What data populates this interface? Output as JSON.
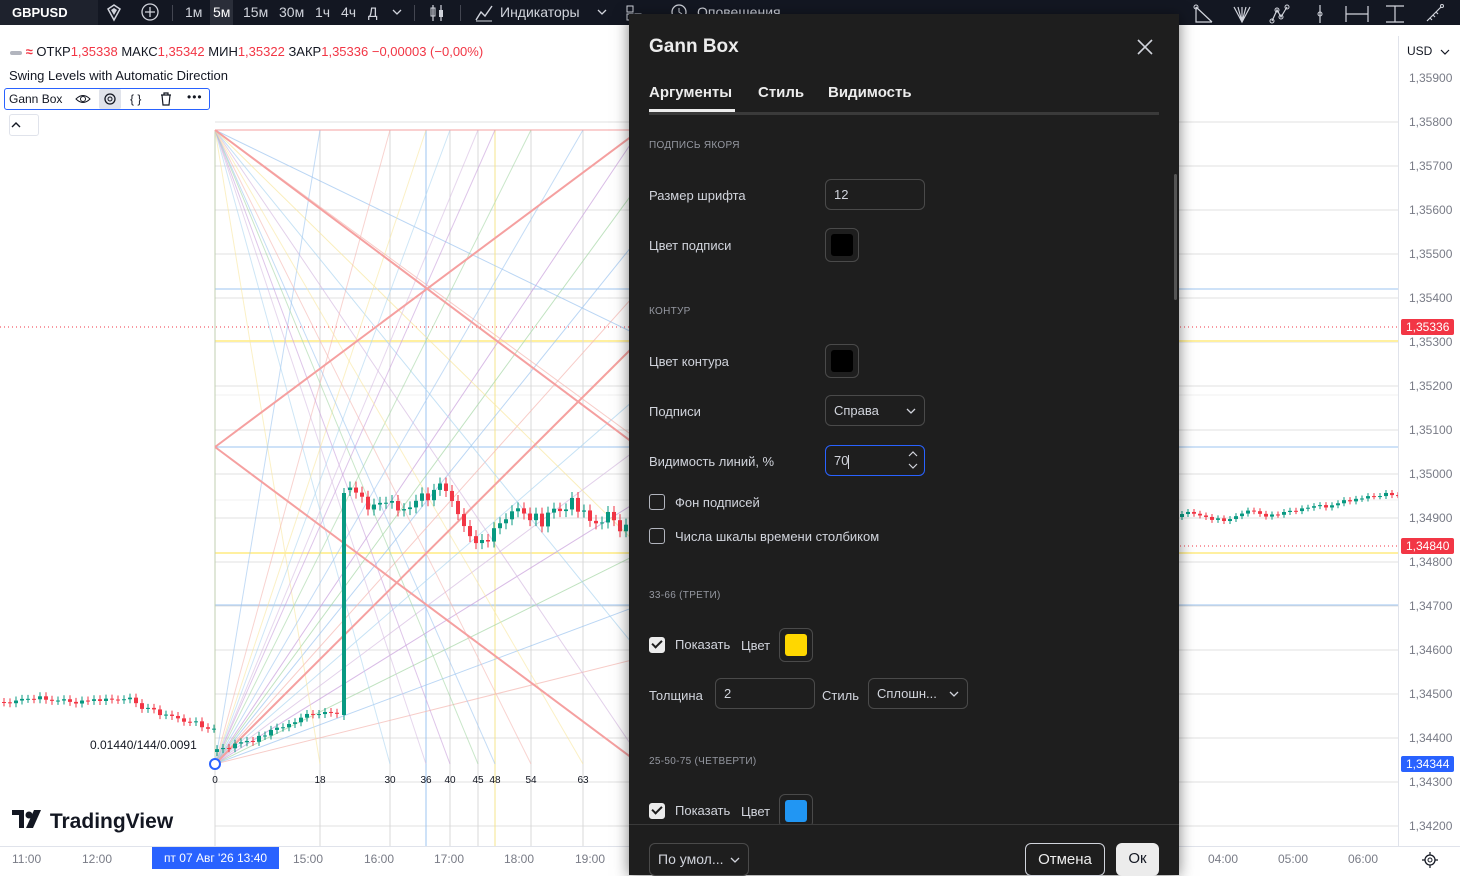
{
  "toolbar": {
    "symbol": "GBPUSD",
    "timeframes": [
      "1м",
      "5м",
      "15м",
      "30м",
      "1ч",
      "4ч",
      "Д"
    ],
    "active_timeframe": "5м",
    "indicators_label": "Индикаторы",
    "alerts_label": "Оповещения"
  },
  "legend": {
    "open_label": "ОТКР",
    "open_value": "1,35338",
    "high_label": "МАКС",
    "high_value": "1,35342",
    "low_label": "МИН",
    "low_value": "1,35322",
    "close_label": "ЗАКР",
    "close_value": "1,35336",
    "change": "−0,00003 (−0,00%)",
    "indicator_name": "Swing Levels with Automatic Direction",
    "drawing_name": "Gann Box"
  },
  "gann": {
    "anchor_label": "0.01440/144/0.0091",
    "time_labels": [
      "0",
      "18",
      "30",
      "36",
      "40",
      "45",
      "48",
      "54",
      "63"
    ]
  },
  "price_scale": {
    "currency": "USD",
    "labels": [
      "1,35900",
      "1,35800",
      "1,35700",
      "1,35600",
      "1,35500",
      "1,35400",
      "1,35300",
      "1,35200",
      "1,35100",
      "1,35000",
      "1,34900",
      "1,34800",
      "1,34700",
      "1,34600",
      "1,34500",
      "1,34400",
      "1,34300",
      "1,34200"
    ],
    "last_price": "1,35336",
    "current_price": "1,34840",
    "crosshair_price": "1,34344",
    "colors": {
      "last": "#f23645",
      "current": "#f23645",
      "crosshair": "#2962ff"
    }
  },
  "time_scale": {
    "labels": [
      "11:00",
      "12:00",
      "15:00",
      "16:00",
      "17:00",
      "18:00",
      "19:00",
      "04:00",
      "05:00",
      "06:00"
    ],
    "crosshair_time": "пт 07 Авг '26   13:40"
  },
  "branding": {
    "logo_text": "TradingView"
  },
  "dialog": {
    "title": "Gann Box",
    "tabs": [
      "Аргументы",
      "Стиль",
      "Видимость"
    ],
    "active_tab": "Аргументы",
    "sections": {
      "anchor": "ПОДПИСЬ ЯКОРЯ",
      "contour": "КОНТУР",
      "thirds": "33-66 (ТРЕТИ)",
      "quarters": "25-50-75 (ЧЕТВЕРТИ)"
    },
    "font_size_label": "Размер шрифта",
    "font_size_value": "12",
    "label_color_label": "Цвет подписи",
    "label_color": "#000000",
    "contour_color_label": "Цвет контура",
    "contour_color": "#000000",
    "labels_label": "Подписи",
    "labels_value": "Справа",
    "lines_visibility_label": "Видимость линий, %",
    "lines_visibility_value": "70",
    "labels_bg_label": "Фон подписей",
    "labels_bg_checked": false,
    "time_numbers_label": "Числа шкалы времени столбиком",
    "time_numbers_checked": false,
    "thirds": {
      "show_label": "Показать",
      "color_label": "Цвет",
      "checked": true,
      "color": "#ffd700",
      "thickness_label": "Толщина",
      "thickness_value": "2",
      "style_label": "Стиль",
      "style_value": "Сплошн..."
    },
    "quarters": {
      "show_label": "Показать",
      "color_label": "Цвет",
      "checked": true,
      "color": "#2196f3"
    },
    "footer": {
      "defaults": "По умол...",
      "cancel": "Отмена",
      "ok": "Ок"
    }
  }
}
